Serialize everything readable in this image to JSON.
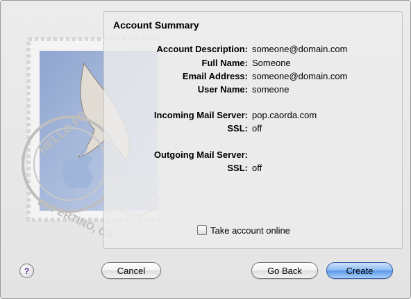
{
  "panel": {
    "title": "Account Summary",
    "rows": [
      {
        "label": "Account Description:",
        "value": "someone@domain.com"
      },
      {
        "label": "Full Name:",
        "value": "Someone"
      },
      {
        "label": "Email Address:",
        "value": "someone@domain.com"
      },
      {
        "label": "User Name:",
        "value": "someone"
      },
      {
        "label": "Incoming Mail Server:",
        "value": "pop.caorda.com"
      },
      {
        "label": "SSL:",
        "value": "off"
      },
      {
        "label": "Outgoing Mail Server:",
        "value": ""
      },
      {
        "label": "SSL:",
        "value": "off"
      }
    ],
    "checkbox": {
      "label": "Take account online",
      "checked": false
    }
  },
  "stamp": {
    "text_top": "HELLO FR",
    "text_bottom": "CUPERTINO, CA"
  },
  "buttons": {
    "help": "?",
    "cancel": "Cancel",
    "back": "Go Back",
    "create": "Create"
  },
  "colors": {
    "default_button": "#5b98ea",
    "window_bg": "#e8e8e8",
    "stamp_blue": "#9db4d8"
  },
  "icons": {
    "stamp": "mail-stamp-icon",
    "help": "question-mark-icon",
    "checkbox": "checkbox-unchecked-icon"
  }
}
